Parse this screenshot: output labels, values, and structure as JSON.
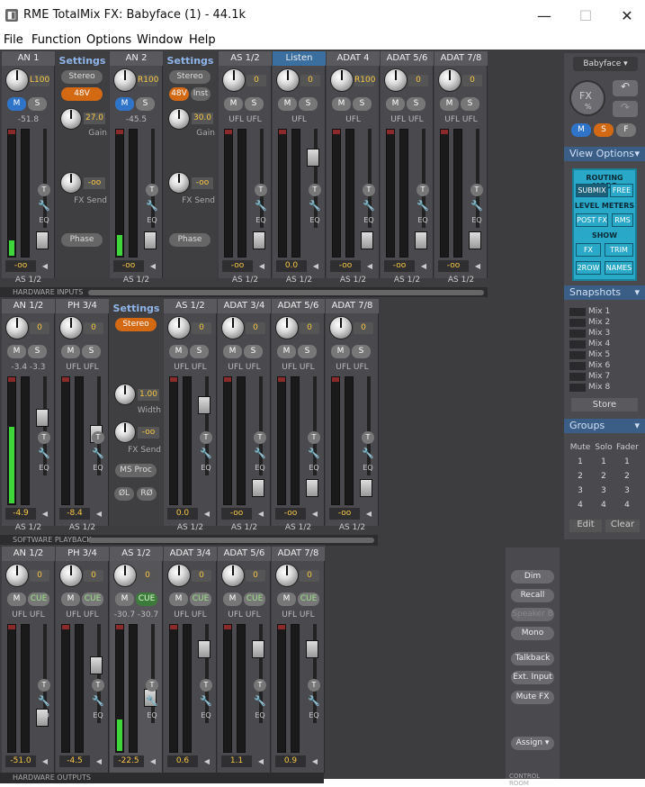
{
  "window": {
    "title": "RME TotalMix FX: Babyface (1) - 44.1k",
    "minimize": "—",
    "maximize": "☐",
    "close": "✕"
  },
  "menu": [
    "File",
    "Function",
    "Options",
    "Window",
    "Help"
  ],
  "row1": {
    "label": "HARDWARE INPUTS",
    "strips": [
      {
        "name": "AN 1",
        "knob": "L100",
        "m": "M",
        "s": "S",
        "m_on": true,
        "level": "-51.8",
        "meter_fill": 0.12,
        "fader_pos": 0.95,
        "fval": "-oo",
        "as": "AS 1/2"
      },
      {
        "name": "AN 2",
        "knob": "R100",
        "m": "M",
        "s": "S",
        "m_on": true,
        "level": "-45.5",
        "meter_fill": 0.16,
        "fader_pos": 0.95,
        "fval": "-oo",
        "as": "AS 1/2"
      },
      {
        "name": "AS 1/2",
        "knob": "0",
        "m": "M",
        "s": "S",
        "level": "UFL  UFL",
        "meter_fill": 0,
        "fader_pos": 0.95,
        "fval": "-oo",
        "as": "AS 1/2"
      },
      {
        "name": "Listen",
        "knob": "0",
        "m": "M",
        "s": "S",
        "level": "UFL",
        "meter_fill": 0,
        "fader_pos": 0.18,
        "fval": "0.0",
        "as": "AS 1/2",
        "hl": true
      },
      {
        "name": "ADAT 4",
        "knob": "R100",
        "m": "M",
        "s": "S",
        "level": "UFL",
        "meter_fill": 0,
        "fader_pos": 0.95,
        "fval": "-oo",
        "as": "AS 1/2"
      },
      {
        "name": "ADAT 5/6",
        "knob": "0",
        "m": "M",
        "s": "S",
        "level": "UFL  UFL",
        "meter_fill": 0,
        "fader_pos": 0.95,
        "fval": "-oo",
        "as": "AS 1/2"
      },
      {
        "name": "ADAT 7/8",
        "knob": "0",
        "m": "M",
        "s": "S",
        "level": "UFL  UFL",
        "meter_fill": 0,
        "fader_pos": 0.95,
        "fval": "-oo",
        "as": "AS 1/2"
      }
    ],
    "settings": [
      {
        "title": "Settings",
        "stereo": "Stereo",
        "btn48": "48V",
        "inst": "",
        "gain": "27.0",
        "gain_label": "Gain",
        "fxsend": "-oo",
        "fxsend_label": "FX Send",
        "phase": "Phase"
      },
      {
        "title": "Settings",
        "stereo": "Stereo",
        "btn48": "48V",
        "inst": "Inst",
        "gain": "30.0",
        "gain_label": "Gain",
        "fxsend": "-oo",
        "fxsend_label": "FX Send",
        "phase": "Phase"
      }
    ]
  },
  "row2": {
    "label": "SOFTWARE PLAYBACK",
    "strips": [
      {
        "name": "AN 1/2",
        "knob": "0",
        "m": "M",
        "s": "S",
        "level": "-3.4  -3.3",
        "meter_fill": 0.6,
        "fader_pos": 0.3,
        "fval": "-4.9",
        "as": "AS 1/2"
      },
      {
        "name": "PH 3/4",
        "knob": "0",
        "m": "M",
        "s": "S",
        "level": "UFL  UFL",
        "meter_fill": 0,
        "fader_pos": 0.45,
        "fval": "-8.4",
        "as": "AS 1/2"
      },
      {
        "name": "AS 1/2",
        "knob": "0",
        "m": "M",
        "s": "S",
        "level": "UFL  UFL",
        "meter_fill": 0,
        "fader_pos": 0.18,
        "fval": "0.0",
        "as": "AS 1/2"
      },
      {
        "name": "ADAT 3/4",
        "knob": "0",
        "m": "M",
        "s": "S",
        "level": "UFL  UFL",
        "meter_fill": 0,
        "fader_pos": 0.95,
        "fval": "-oo",
        "as": "AS 1/2"
      },
      {
        "name": "ADAT 5/6",
        "knob": "0",
        "m": "M",
        "s": "S",
        "level": "UFL  UFL",
        "meter_fill": 0,
        "fader_pos": 0.95,
        "fval": "-oo",
        "as": "AS 1/2"
      },
      {
        "name": "ADAT 7/8",
        "knob": "0",
        "m": "M",
        "s": "S",
        "level": "UFL  UFL",
        "meter_fill": 0,
        "fader_pos": 0.95,
        "fval": "-oo",
        "as": "AS 1/2"
      }
    ],
    "settings": {
      "title": "Settings",
      "stereo": "Stereo",
      "width": "1.00",
      "width_label": "Width",
      "fxsend": "-oo",
      "fxsend_label": "FX Send",
      "msproc": "MS Proc",
      "phl": "ØL",
      "phr": "RØ"
    }
  },
  "row3": {
    "label": "HARDWARE OUTPUTS",
    "strips": [
      {
        "name": "AN 1/2",
        "knob": "0",
        "m": "M",
        "s": "CUE",
        "level": "UFL  UFL",
        "meter_fill": 0,
        "fader_pos": 0.78,
        "fval": "-51.0"
      },
      {
        "name": "PH 3/4",
        "knob": "0",
        "m": "M",
        "s": "CUE",
        "level": "UFL  UFL",
        "meter_fill": 0,
        "fader_pos": 0.3,
        "fval": "-4.5"
      },
      {
        "name": "AS 1/2",
        "knob": "0",
        "m": "M",
        "s": "CUE",
        "s_on": true,
        "level": "-30.7 -30.7",
        "meter_fill": 0.25,
        "fader_pos": 0.6,
        "fval": "-22.5",
        "sel": true
      },
      {
        "name": "ADAT 3/4",
        "knob": "0",
        "m": "M",
        "s": "CUE",
        "level": "UFL  UFL",
        "meter_fill": 0,
        "fader_pos": 0.15,
        "fval": "0.6"
      },
      {
        "name": "ADAT 5/6",
        "knob": "0",
        "m": "M",
        "s": "CUE",
        "level": "UFL  UFL",
        "meter_fill": 0,
        "fader_pos": 0.15,
        "fval": "1.1"
      },
      {
        "name": "ADAT 7/8",
        "knob": "0",
        "m": "M",
        "s": "CUE",
        "level": "UFL  UFL",
        "meter_fill": 0,
        "fader_pos": 0.15,
        "fval": "0.9"
      }
    ]
  },
  "right": {
    "device": "Babyface",
    "fx": "FX",
    "fx_pct": "%",
    "msf": [
      "M",
      "S",
      "F"
    ],
    "view_options": "View Options",
    "routing_mode": "ROUTING MODE",
    "submix": "SUBMIX",
    "free": "FREE",
    "level_meters": "LEVEL METERS",
    "postfx": "POST FX",
    "rms": "RMS",
    "show": "SHOW",
    "fxb": "FX",
    "trim": "TRIM",
    "row2": "2ROW",
    "names": "NAMES",
    "snapshots": "Snapshots",
    "mixes": [
      "Mix 1",
      "Mix 2",
      "Mix 3",
      "Mix 4",
      "Mix 5",
      "Mix 6",
      "Mix 7",
      "Mix 8"
    ],
    "store": "Store",
    "groups": "Groups",
    "group_headers": [
      "Mute",
      "Solo",
      "Fader"
    ],
    "group_rows": [
      [
        "1",
        "1",
        "1"
      ],
      [
        "2",
        "2",
        "2"
      ],
      [
        "3",
        "3",
        "3"
      ],
      [
        "4",
        "4",
        "4"
      ]
    ],
    "edit": "Edit",
    "clear": "Clear"
  },
  "control": {
    "dim": "Dim",
    "recall": "Recall",
    "speakerb": "Speaker B",
    "mono": "Mono",
    "talkback": "Talkback",
    "extinput": "Ext. Input",
    "mutefx": "Mute FX",
    "assign": "Assign",
    "label": "CONTROL ROOM"
  }
}
